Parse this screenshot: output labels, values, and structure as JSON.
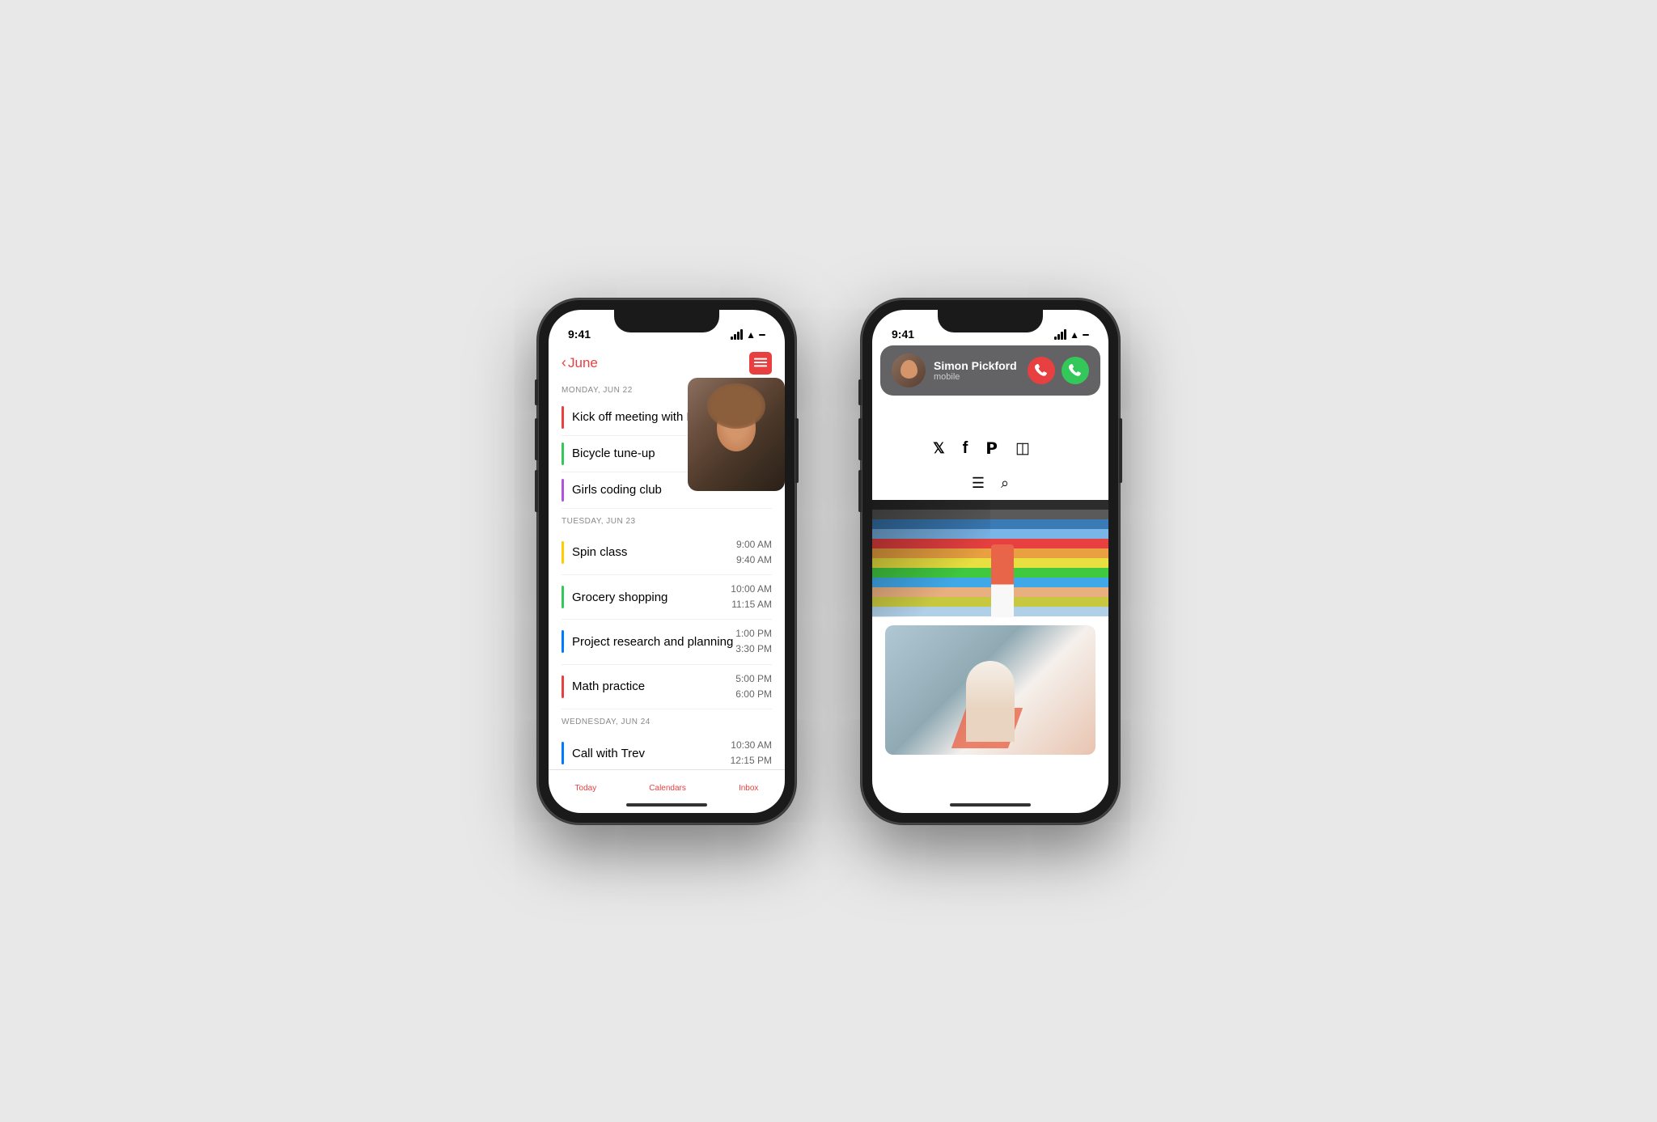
{
  "scene": {
    "background": "#e8e8e8"
  },
  "phone1": {
    "status": {
      "time": "9:41",
      "signal": "●●●●",
      "wifi": "WiFi",
      "battery": "Battery"
    },
    "header": {
      "back_label": "June",
      "back_chevron": "‹"
    },
    "days": [
      {
        "label": "MONDAY, JUN 22",
        "events": [
          {
            "name": "Kick off meeting with Ron",
            "color": "#e84040",
            "start": "",
            "end": ""
          },
          {
            "name": "Bicycle tune-up",
            "color": "#34c759",
            "start": "",
            "end": ""
          },
          {
            "name": "Girls coding club",
            "color": "#af52de",
            "start": "",
            "end": ""
          }
        ]
      },
      {
        "label": "TUESDAY, JUN 23",
        "events": [
          {
            "name": "Spin class",
            "color": "#ffcc00",
            "start": "9:00 AM",
            "end": "9:40 AM"
          },
          {
            "name": "Grocery shopping",
            "color": "#34c759",
            "start": "10:00 AM",
            "end": "11:15 AM"
          },
          {
            "name": "Project research and planning",
            "color": "#007aff",
            "start": "1:00 PM",
            "end": "3:30 PM"
          },
          {
            "name": "Math practice",
            "color": "#e84040",
            "start": "5:00 PM",
            "end": "6:00 PM"
          }
        ]
      },
      {
        "label": "WEDNESDAY, JUN 24",
        "events": [
          {
            "name": "Call with Trev",
            "color": "#007aff",
            "start": "10:30 AM",
            "end": "12:15 PM"
          }
        ]
      }
    ],
    "tab_bar": {
      "tabs": [
        "Today",
        "Calendars",
        "Inbox"
      ]
    }
  },
  "phone2": {
    "status": {
      "time": "9:41"
    },
    "call_banner": {
      "name": "Simon Pickford",
      "sub": "mobile",
      "decline_label": "✕",
      "accept_label": "✓"
    },
    "web": {
      "social_icons": [
        "𝕏",
        "f",
        "𝗣",
        "◻",
        ""
      ],
      "nav_icons": [
        "☰",
        "⌕"
      ]
    }
  }
}
